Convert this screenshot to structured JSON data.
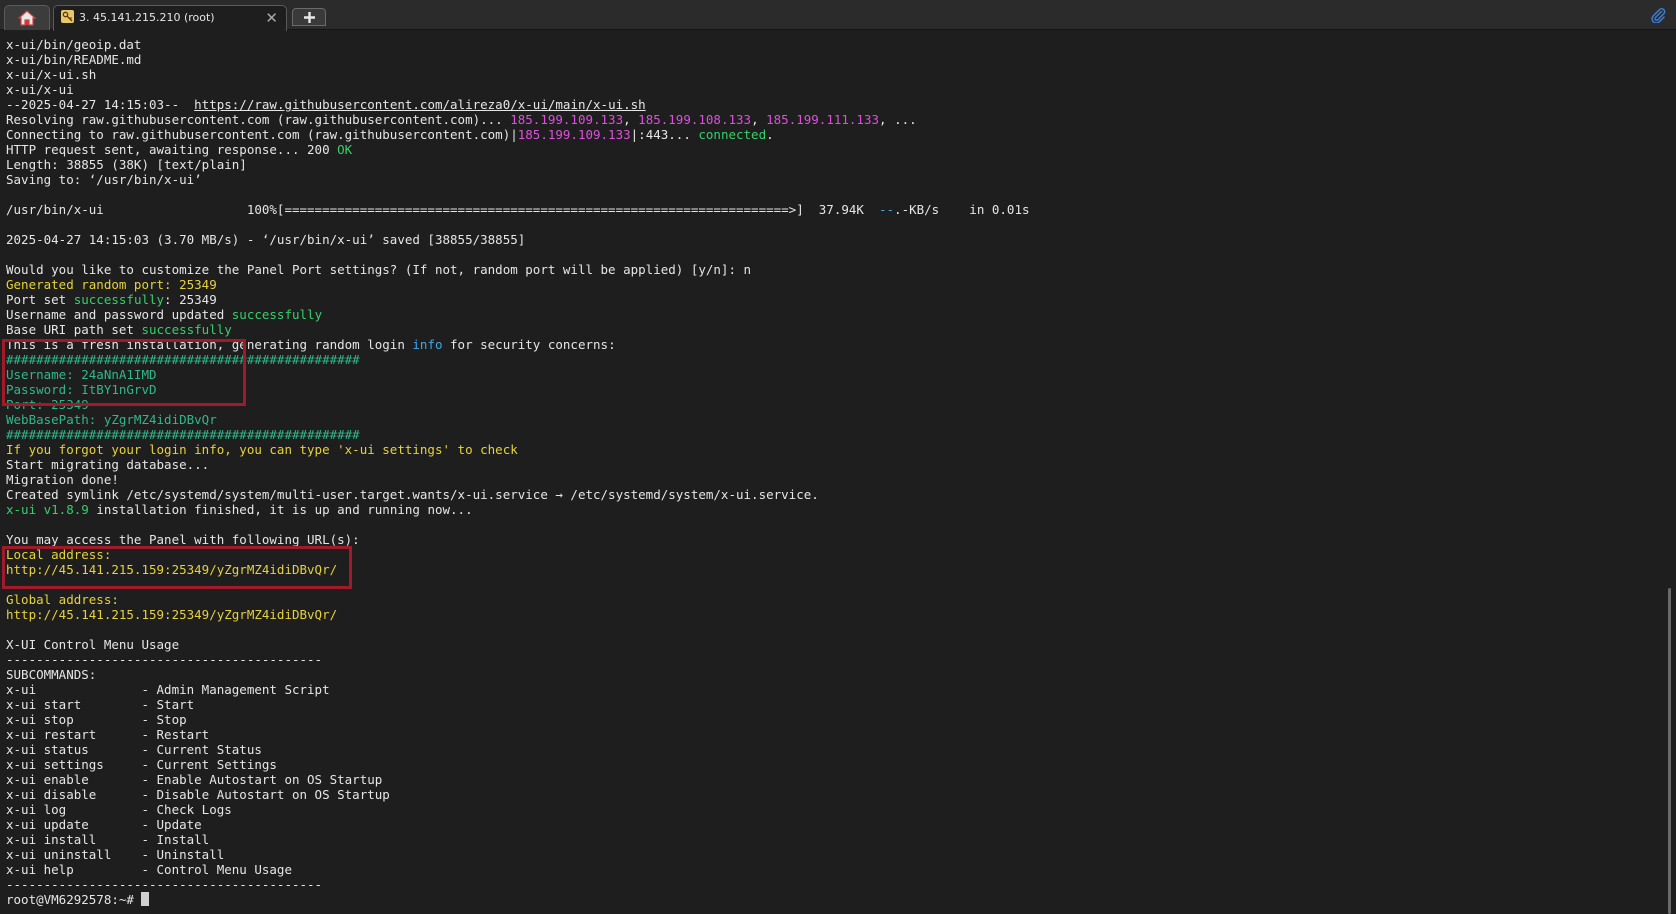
{
  "tabs": {
    "home_icon": "home-icon",
    "session_label": "3. 45.141.215.210 (root)",
    "session_icon": "key-icon",
    "close_glyph": "✕",
    "new_tab_icon": "plus-icon"
  },
  "colors": {
    "background": "#1e1e1e",
    "text": "#e6e6e6",
    "ip_magenta": "#e04ee0",
    "green": "#35d06a",
    "yellow": "#e6d23c",
    "teal": "#2fb88a",
    "cyan": "#3da8e8",
    "highlight_box": "#a01a2a"
  },
  "terminal": {
    "lines": [
      [
        {
          "t": "x-ui/bin/geoip.dat"
        }
      ],
      [
        {
          "t": "x-ui/bin/README.md"
        }
      ],
      [
        {
          "t": "x-ui/x-ui.sh"
        }
      ],
      [
        {
          "t": "x-ui/x-ui"
        }
      ],
      [
        {
          "t": "--2025-04-27 14:15:03--  "
        },
        {
          "t": "https://raw.githubusercontent.com/alireza0/x-ui/main/x-ui.sh",
          "c": "link"
        }
      ],
      [
        {
          "t": "Resolving raw.githubusercontent.com (raw.githubusercontent.com)... "
        },
        {
          "t": "185.199.109.133",
          "c": "magenta"
        },
        {
          "t": ", "
        },
        {
          "t": "185.199.108.133",
          "c": "magenta"
        },
        {
          "t": ", "
        },
        {
          "t": "185.199.111.133",
          "c": "magenta"
        },
        {
          "t": ", ..."
        }
      ],
      [
        {
          "t": "Connecting to raw.githubusercontent.com (raw.githubusercontent.com)|"
        },
        {
          "t": "185.199.109.133",
          "c": "magenta"
        },
        {
          "t": "|:443... "
        },
        {
          "t": "connected",
          "c": "green"
        },
        {
          "t": "."
        }
      ],
      [
        {
          "t": "HTTP request sent, awaiting response... 200 "
        },
        {
          "t": "OK",
          "c": "green"
        }
      ],
      [
        {
          "t": "Length: 38855 (38K) [text/plain]"
        }
      ],
      [
        {
          "t": "Saving to: ‘/usr/bin/x-ui’"
        }
      ],
      [
        {
          "t": ""
        }
      ],
      [
        {
          "t": "/usr/bin/x-ui                   100%[===================================================================>]  37.94K  "
        },
        {
          "t": "--",
          "c": "cyan"
        },
        {
          "t": ".-KB/s    in 0.01s"
        }
      ],
      [
        {
          "t": ""
        }
      ],
      [
        {
          "t": "2025-04-27 14:15:03 (3.70 MB/s) - ‘/usr/bin/x-ui’ saved [38855/38855]"
        }
      ],
      [
        {
          "t": ""
        }
      ],
      [
        {
          "t": "Would you like to customize the Panel Port settings? (If not, random port will be applied) [y/n]: n"
        }
      ],
      [
        {
          "t": "Generated random port: 25349",
          "c": "yellow"
        }
      ],
      [
        {
          "t": "Port set "
        },
        {
          "t": "successfully",
          "c": "green"
        },
        {
          "t": ": 25349"
        }
      ],
      [
        {
          "t": "Username and password updated "
        },
        {
          "t": "successfully",
          "c": "green"
        }
      ],
      [
        {
          "t": "Base URI path set "
        },
        {
          "t": "successfully",
          "c": "green"
        }
      ],
      [
        {
          "t": "This is a fresh installation, generating random login "
        },
        {
          "t": "info",
          "c": "cyan"
        },
        {
          "t": " for security concerns:"
        }
      ],
      [
        {
          "t": "###############################################",
          "c": "teal"
        }
      ],
      [
        {
          "t": "Username: 24aNnA1IMD",
          "c": "teal"
        }
      ],
      [
        {
          "t": "Password: ItBY1nGrvD",
          "c": "teal"
        }
      ],
      [
        {
          "t": "Port: 25349",
          "c": "teal"
        }
      ],
      [
        {
          "t": "WebBasePath: yZgrMZ4idiDBvQr",
          "c": "teal"
        }
      ],
      [
        {
          "t": "###############################################",
          "c": "teal"
        }
      ],
      [
        {
          "t": "If you forgot your login info, you can type 'x-ui settings' to check",
          "c": "yellow"
        }
      ],
      [
        {
          "t": "Start migrating database..."
        }
      ],
      [
        {
          "t": "Migration done!"
        }
      ],
      [
        {
          "t": "Created symlink /etc/systemd/system/multi-user.target.wants/x-ui.service → /etc/systemd/system/x-ui.service."
        }
      ],
      [
        {
          "t": "x-ui v1.8.9",
          "c": "green"
        },
        {
          "t": " installation finished, it is up and running now..."
        }
      ],
      [
        {
          "t": ""
        }
      ],
      [
        {
          "t": "You may access the Panel with following URL(s):"
        }
      ],
      [
        {
          "t": "Local address:",
          "c": "yellow"
        }
      ],
      [
        {
          "t": "http://45.141.215.159:25349/yZgrMZ4idiDBvQr/",
          "c": "yellow"
        }
      ],
      [
        {
          "t": ""
        }
      ],
      [
        {
          "t": "Global address:",
          "c": "yellow"
        }
      ],
      [
        {
          "t": "http://45.141.215.159:25349/yZgrMZ4idiDBvQr/",
          "c": "yellow"
        }
      ],
      [
        {
          "t": ""
        }
      ],
      [
        {
          "t": "X-UI Control Menu Usage"
        }
      ],
      [
        {
          "t": "------------------------------------------"
        }
      ],
      [
        {
          "t": "SUBCOMMANDS:"
        }
      ],
      [
        {
          "t": "x-ui              - Admin Management Script"
        }
      ],
      [
        {
          "t": "x-ui start        - Start"
        }
      ],
      [
        {
          "t": "x-ui stop         - Stop"
        }
      ],
      [
        {
          "t": "x-ui restart      - Restart"
        }
      ],
      [
        {
          "t": "x-ui status       - Current Status"
        }
      ],
      [
        {
          "t": "x-ui settings     - Current Settings"
        }
      ],
      [
        {
          "t": "x-ui enable       - Enable Autostart on OS Startup"
        }
      ],
      [
        {
          "t": "x-ui disable      - Disable Autostart on OS Startup"
        }
      ],
      [
        {
          "t": "x-ui log          - Check Logs"
        }
      ],
      [
        {
          "t": "x-ui update       - Update"
        }
      ],
      [
        {
          "t": "x-ui install      - Install"
        }
      ],
      [
        {
          "t": "x-ui uninstall    - Uninstall"
        }
      ],
      [
        {
          "t": "x-ui help         - Control Menu Usage"
        }
      ],
      [
        {
          "t": "------------------------------------------"
        }
      ]
    ],
    "prompt": "root@VM6292578:~# "
  }
}
